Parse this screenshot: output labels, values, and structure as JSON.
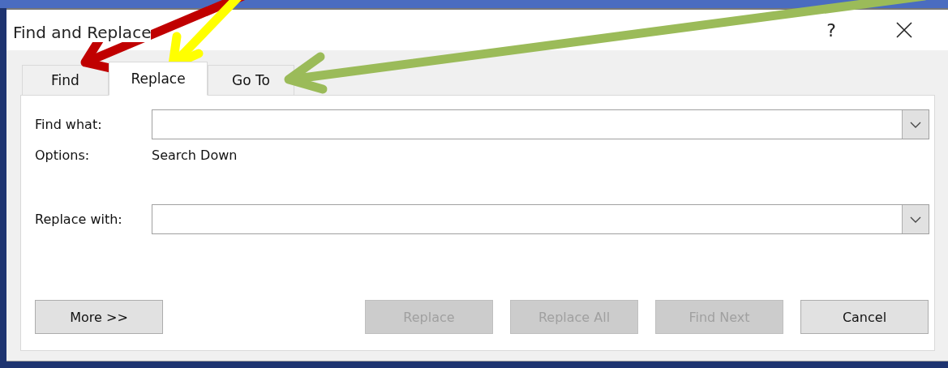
{
  "window": {
    "title": "Find and Replace",
    "help": "?"
  },
  "tabs": [
    {
      "label": "Find",
      "selected": false
    },
    {
      "label": "Replace",
      "selected": true
    },
    {
      "label": "Go To",
      "selected": false
    }
  ],
  "find_field": {
    "label": "Find what:"
  },
  "options": {
    "label": "Options:",
    "value": "Search Down"
  },
  "replace_field": {
    "label": "Replace with:"
  },
  "buttons": [
    {
      "label": "More >>",
      "disabled": false
    },
    {
      "label": "Replace",
      "disabled": true
    },
    {
      "label": "Replace All",
      "disabled": true
    },
    {
      "label": "Find Next",
      "disabled": true
    },
    {
      "label": "Cancel",
      "disabled": false
    }
  ],
  "annotations": [
    {
      "kind": "arrow",
      "color": "#c00000"
    },
    {
      "kind": "arrow",
      "color": "#ffff00"
    },
    {
      "kind": "arrow",
      "color": "#9bbb59"
    }
  ]
}
